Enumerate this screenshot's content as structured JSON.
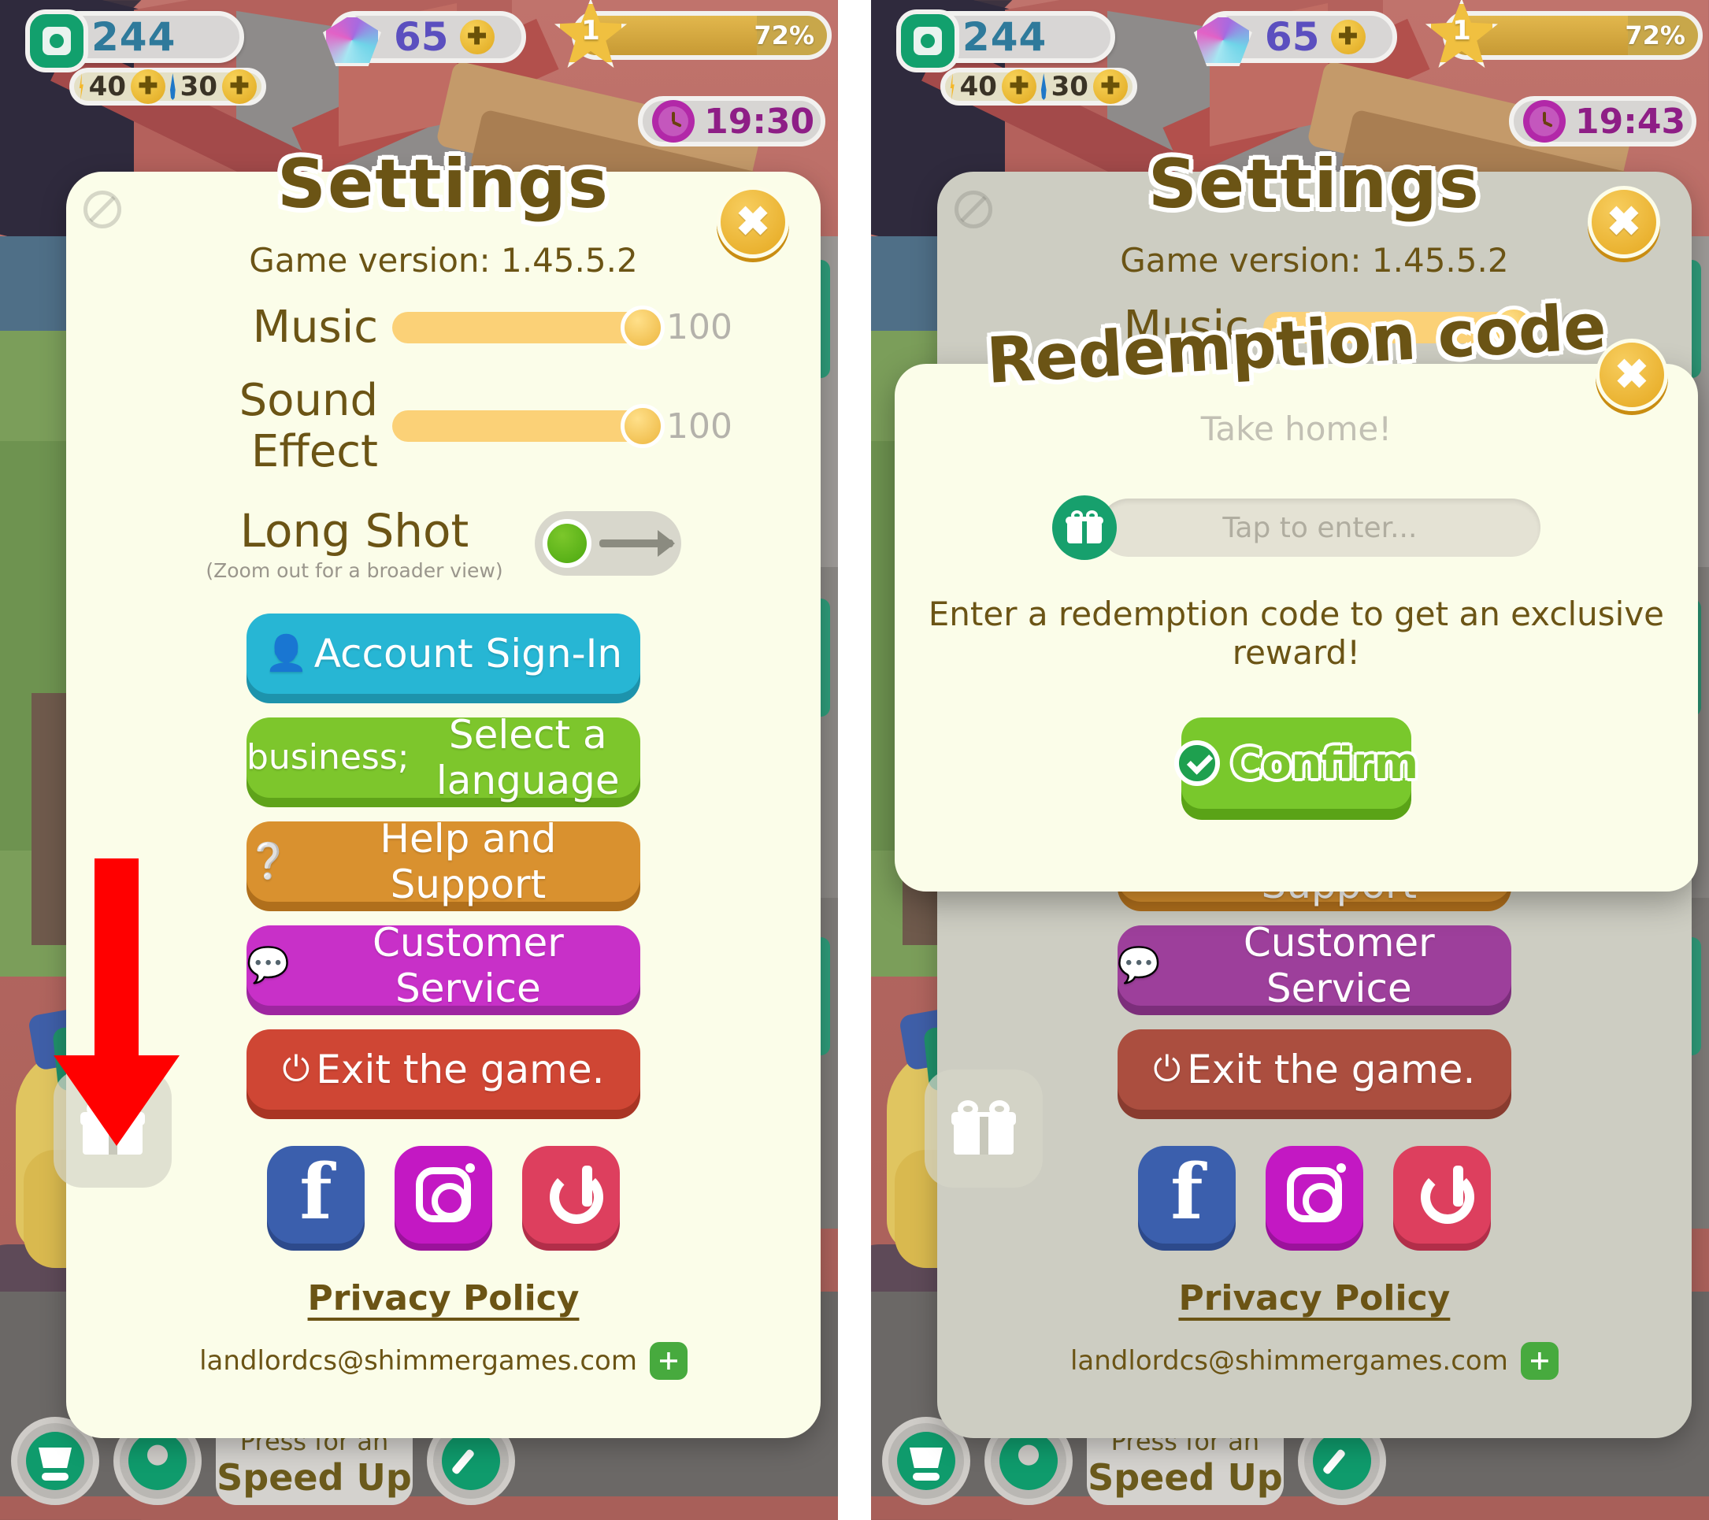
{
  "hud": {
    "coins": "244",
    "energy": "40",
    "water": "30",
    "gems": "65",
    "level": "1",
    "level_progress": "72%",
    "timer_left": "19:30",
    "timer_right": "19:43",
    "coin_icon": "coin-icon",
    "gem_icon": "gem-icon",
    "bolt_icon": "energy-bolt-icon",
    "drop_icon": "water-drop-icon",
    "star_icon": "level-star-icon",
    "clock_icon": "clock-icon",
    "plus_icon": "plus-icon"
  },
  "dock": {
    "speed_pre": "Press for an",
    "speed_label": "Speed Up",
    "cart_icon": "shop-cart-icon",
    "ring_icon": "ring-icon",
    "tool_icon": "tool-icon"
  },
  "settings": {
    "title": "Settings",
    "game_version": "Game version: 1.45.5.2",
    "close_icon": "close-icon",
    "blocked_icon": "no-entry-icon",
    "music": {
      "label": "Music",
      "value": "100"
    },
    "sound_effect": {
      "label": "Sound Effect",
      "value": "100"
    },
    "long_shot": {
      "label": "Long Shot",
      "subtitle": "(Zoom out for a broader view)",
      "toggle_icon": "toggle-switch-icon",
      "state": "on"
    },
    "buttons": [
      {
        "label": "Account Sign-In",
        "icon": "👤",
        "icon_name": "person-icon",
        "color": "#27b6d4"
      },
      {
        "label": "Select a language",
        "icon": "⊕",
        "icon_name": "globe-icon",
        "color": "#7dc62c"
      },
      {
        "label": "Help and Support",
        "icon": "❓",
        "icon_name": "question-icon",
        "color": "#d9912f"
      },
      {
        "label": "Customer Service",
        "icon": "💬",
        "icon_name": "chat-icon",
        "color": "#c830c8"
      },
      {
        "label": "Exit the game.",
        "icon": "⏻",
        "icon_name": "power-icon",
        "color": "#cf4634"
      }
    ],
    "social": [
      {
        "name": "facebook-icon",
        "color": "#3b5fad"
      },
      {
        "name": "instagram-icon",
        "color": "#c318c3"
      },
      {
        "name": "tiktok-icon",
        "color": "#dd3f5e"
      }
    ],
    "gift_button_icon": "gift-icon",
    "privacy_policy": "Privacy Policy",
    "support_email": "landlordcs@shimmergames.com",
    "copy_icon": "copy-icon"
  },
  "redemption": {
    "title": "Redemption code",
    "subtitle": "Take home!",
    "input_placeholder": "Tap to enter...",
    "input_value": "",
    "hint": "Enter a redemption code to get an exclusive reward!",
    "confirm_label": "Confirm",
    "close_icon": "close-icon",
    "gift_icon": "gift-icon",
    "check_icon": "check-circle-icon"
  },
  "annotation": {
    "arrow_color": "#ff0000",
    "arrow_name": "red-down-arrow-annotation"
  }
}
